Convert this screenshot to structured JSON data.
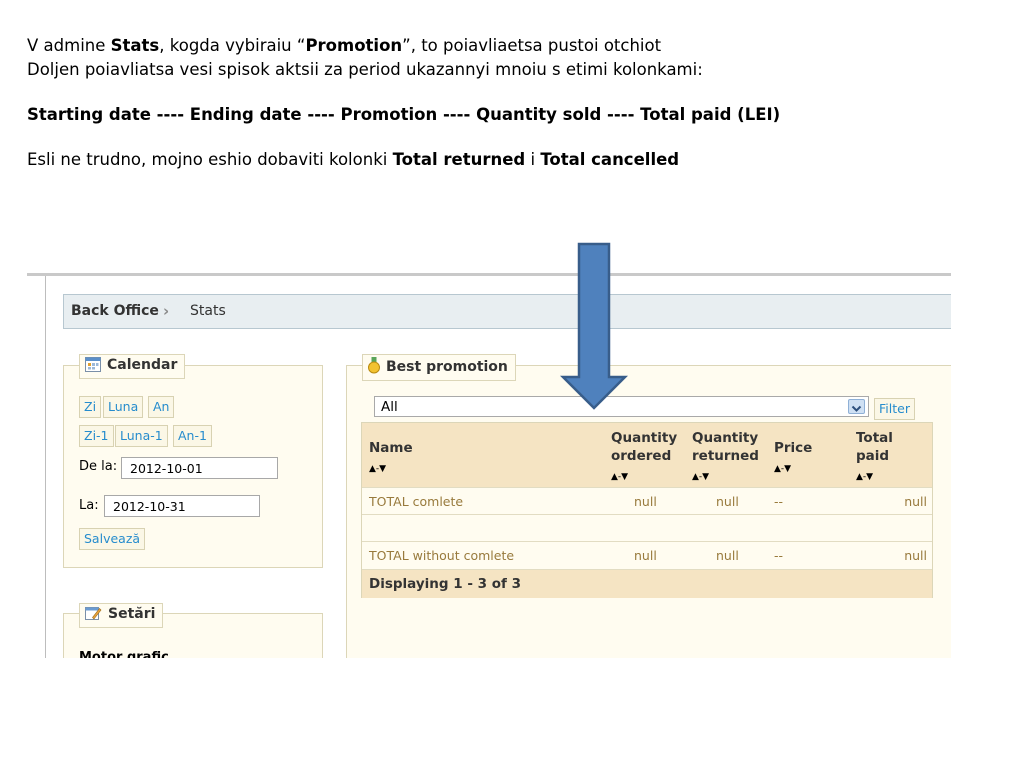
{
  "notes": {
    "line1": {
      "a": "V admine ",
      "b": "Stats",
      "c": ", kogda vybiraiu “",
      "d": "Promotion",
      "e": "”, to poiavliaetsa pustoi otchiot"
    },
    "line2": "Doljen poiavliatsa vesi spisok aktsii za period ukazannyi mnoiu s etimi kolonkami:",
    "line3": "Starting date ---- Ending date  ---- Promotion ---- Quantity sold ---- Total paid (LEI)",
    "line4": {
      "a": "Esli ne trudno, mojno eshio dobaviti kolonki ",
      "b": "Total returned",
      "c": " i ",
      "d": "Total cancelled"
    }
  },
  "breadcrumb": {
    "home": "Back Office",
    "separator": "›",
    "current": "Stats"
  },
  "calendar": {
    "title": "Calendar",
    "buttons_row1": [
      "Zi",
      "Luna",
      "An"
    ],
    "buttons_row2": [
      "Zi-1",
      "Luna-1",
      "An-1"
    ],
    "from_label": "De la:",
    "from_value": "2012-10-01",
    "to_label": "La:",
    "to_value": "2012-10-31",
    "save_label": "Salvează"
  },
  "settings": {
    "title": "Setări",
    "partial_text": "Motor grafic"
  },
  "best_promotion": {
    "title": "Best promotion",
    "select_value": "All",
    "filter_label": "Filter",
    "columns": [
      "Name",
      "Quantity ordered",
      "Quantity returned",
      "Price",
      "Total paid"
    ],
    "column_lines": [
      [
        "Name"
      ],
      [
        "Quantity",
        "ordered"
      ],
      [
        "Quantity",
        "returned"
      ],
      [
        "Price"
      ],
      [
        "Total",
        "paid"
      ]
    ],
    "sort_glyph": "▲-▼",
    "rows": [
      {
        "name": "TOTAL comlete",
        "ordered": "null",
        "returned": "null",
        "price": "--",
        "paid": "null"
      },
      {
        "name": "",
        "ordered": "",
        "returned": "",
        "price": "",
        "paid": ""
      },
      {
        "name": "TOTAL without comlete",
        "ordered": "null",
        "returned": "null",
        "price": "--",
        "paid": "null"
      }
    ],
    "footer": "Displaying 1 - 3 of 3"
  },
  "colors": {
    "arrow_fill": "#4f81bd",
    "arrow_stroke": "#385d8a",
    "link": "#268ccd",
    "panel_bg": "#fffcf0",
    "grid_header": "#f5e4c3"
  },
  "icons": [
    "calendar-icon",
    "medal-icon",
    "settings-icon",
    "chevron-right-icon",
    "dropdown-arrow-icon",
    "down-arrow-annotation"
  ]
}
